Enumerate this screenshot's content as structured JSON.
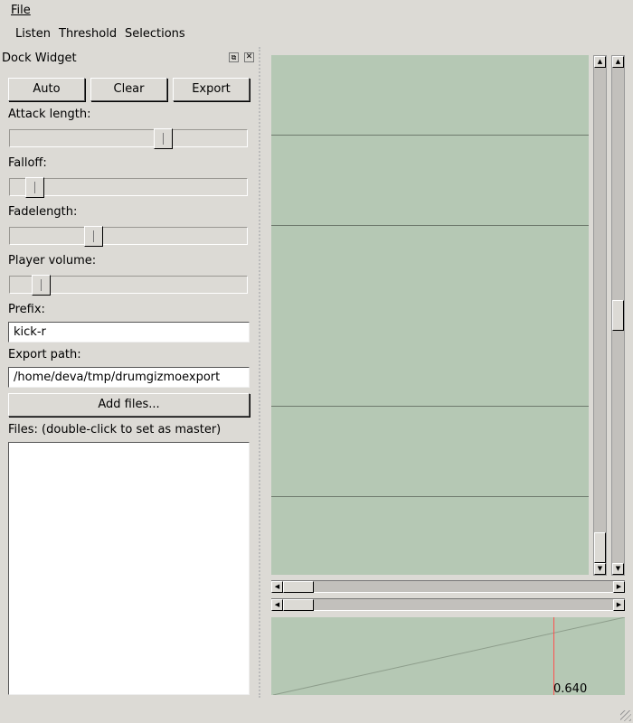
{
  "menubar": {
    "file": "File"
  },
  "toolbar": {
    "listen": "Listen",
    "threshold": "Threshold",
    "selections": "Selections"
  },
  "dock": {
    "title": "Dock Widget",
    "buttons": {
      "auto": "Auto",
      "clear": "Clear",
      "export": "Export"
    },
    "sliders": [
      {
        "label": "Attack length:",
        "value": 0.66
      },
      {
        "label": "Falloff:",
        "value": 0.07
      },
      {
        "label": "Fadelength:",
        "value": 0.34
      },
      {
        "label": "Player volume:",
        "value": 0.1
      }
    ],
    "prefix_label": "Prefix:",
    "prefix_value": "kick-r",
    "export_label": "Export path:",
    "export_value": "/home/deva/tmp/drumgizmoexport",
    "add_files": "Add files...",
    "files_label": "Files: (double-click to set as master)"
  },
  "graph": {
    "threshold_value": "0.640",
    "threshold_color": "#ff5050"
  }
}
